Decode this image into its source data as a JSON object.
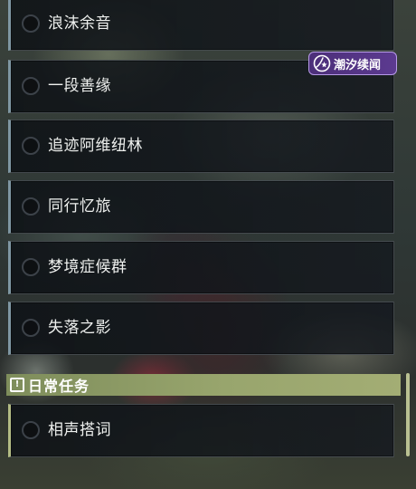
{
  "quests": [
    {
      "title": "浪沫余音"
    },
    {
      "title": "一段善缘"
    },
    {
      "title": "追迹阿维纽林"
    },
    {
      "title": "同行忆旅"
    },
    {
      "title": "梦境症候群"
    },
    {
      "title": "失落之影"
    }
  ],
  "event_tag": {
    "label": "潮汐续闻",
    "icon": "star-swirl-icon",
    "color": "#5c3a90"
  },
  "daily_section": {
    "title": "日常任务",
    "icon": "info-icon",
    "color": "#98a56d"
  },
  "daily_quests": [
    {
      "title": "相声搭词"
    }
  ]
}
